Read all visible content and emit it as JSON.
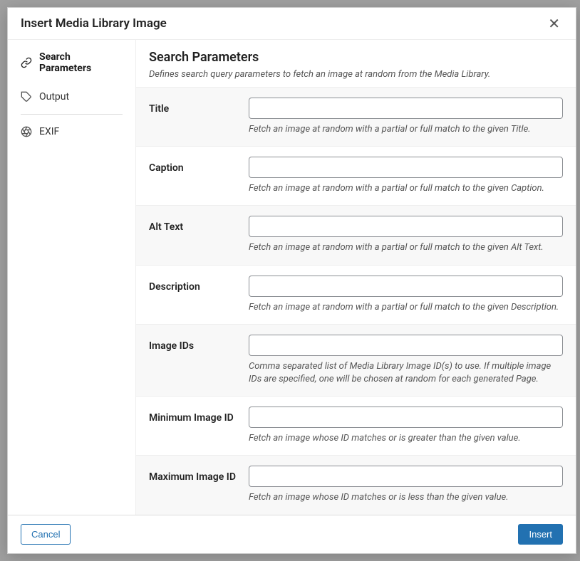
{
  "modal": {
    "title": "Insert Media Library Image"
  },
  "sidebar": {
    "items": [
      {
        "label": "Search Parameters"
      },
      {
        "label": "Output"
      },
      {
        "label": "EXIF"
      }
    ]
  },
  "main": {
    "title": "Search Parameters",
    "description": "Defines search query parameters to fetch an image at random from the Media Library."
  },
  "fields": [
    {
      "label": "Title",
      "help": "Fetch an image at random with a partial or full match to the given Title.",
      "value": ""
    },
    {
      "label": "Caption",
      "help": "Fetch an image at random with a partial or full match to the given Caption.",
      "value": ""
    },
    {
      "label": "Alt Text",
      "help": "Fetch an image at random with a partial or full match to the given Alt Text.",
      "value": ""
    },
    {
      "label": "Description",
      "help": "Fetch an image at random with a partial or full match to the given Description.",
      "value": ""
    },
    {
      "label": "Image IDs",
      "help": "Comma separated list of Media Library Image ID(s) to use. If multiple image IDs are specified, one will be chosen at random for each generated Page.",
      "value": ""
    },
    {
      "label": "Minimum Image ID",
      "help": "Fetch an image whose ID matches or is greater than the given value.",
      "value": ""
    },
    {
      "label": "Maximum Image ID",
      "help": "Fetch an image whose ID matches or is less than the given value.",
      "value": ""
    }
  ],
  "footer": {
    "cancel": "Cancel",
    "insert": "Insert"
  }
}
